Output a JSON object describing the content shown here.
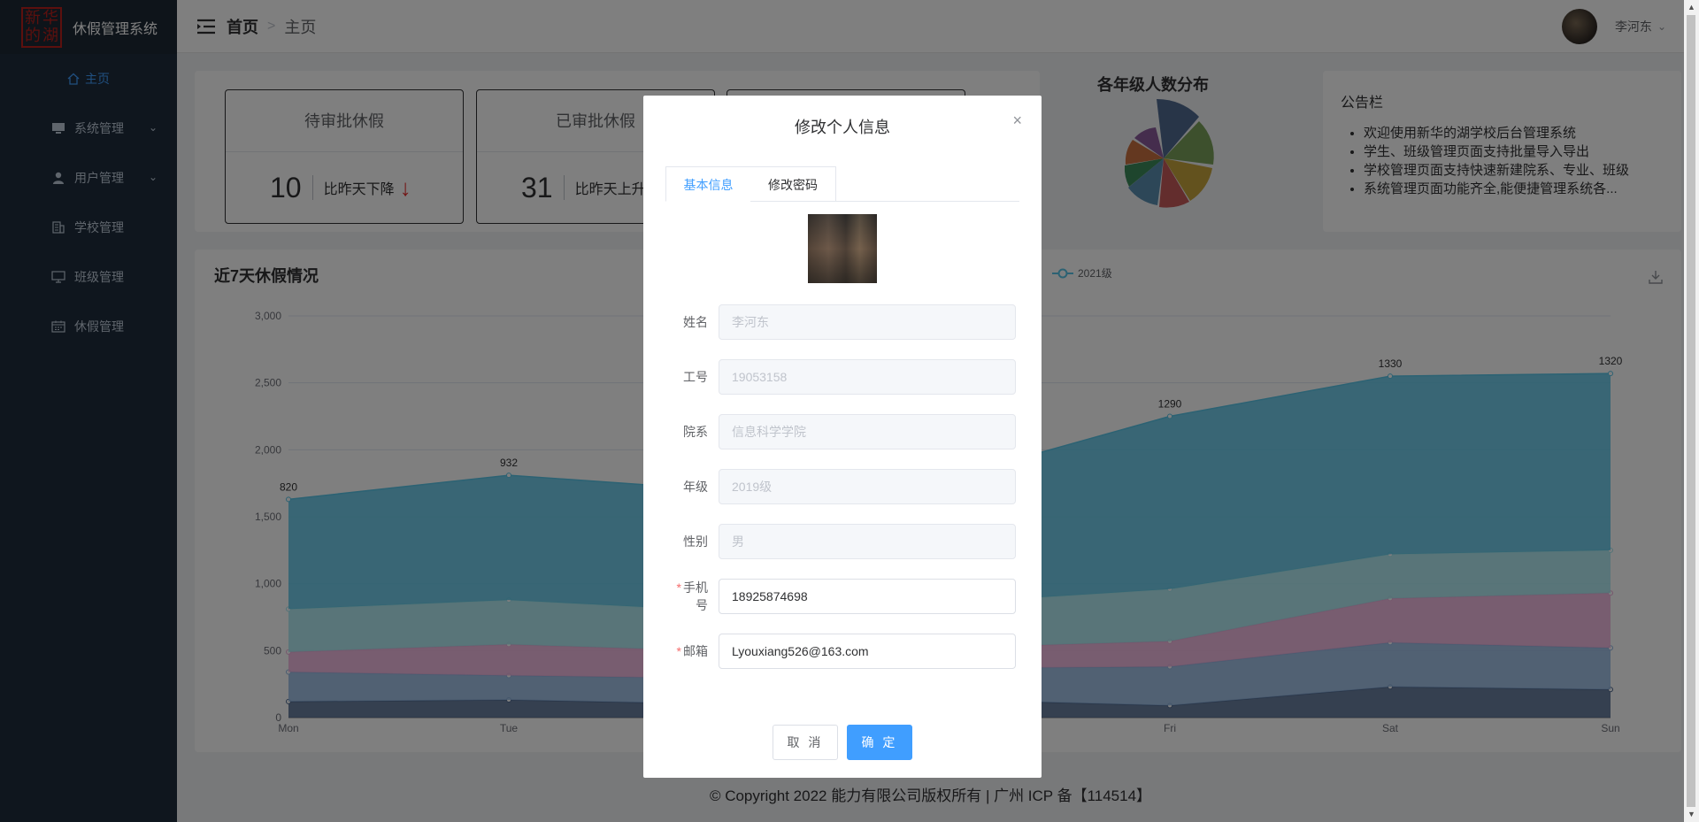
{
  "brand": {
    "logo_chars": [
      "新",
      "华",
      "的",
      "湖"
    ],
    "title": "休假管理系统"
  },
  "sidebar": {
    "items": [
      {
        "label": "主页",
        "icon": "home-icon",
        "active": true
      },
      {
        "label": "系统管理",
        "icon": "monitor-icon",
        "has_arrow": true
      },
      {
        "label": "用户管理",
        "icon": "user-icon",
        "has_arrow": true
      },
      {
        "label": "学校管理",
        "icon": "building-icon"
      },
      {
        "label": "班级管理",
        "icon": "screen-icon"
      },
      {
        "label": "休假管理",
        "icon": "calendar-icon"
      }
    ]
  },
  "header": {
    "crumb_home": "首页",
    "crumb_sep": ">",
    "crumb_current": "主页",
    "user_name": "李河东"
  },
  "stats": [
    {
      "title": "待审批休假",
      "value": "10",
      "text": "比昨天下降",
      "trend": "down"
    },
    {
      "title": "已审批休假",
      "value": "31",
      "text": "比昨天上升",
      "trend": "up"
    }
  ],
  "pie": {
    "title": "各年级人数分布"
  },
  "notice": {
    "title": "公告栏",
    "items": [
      "欢迎使用新华的湖学校后台管理系统",
      "学生、班级管理页面支持批量导入导出",
      "学校管理页面支持快速新建院系、专业、班级",
      "系统管理页面功能齐全,能便捷管理系统各..."
    ]
  },
  "chart_data": {
    "type": "area",
    "title": "近7天休假情况",
    "categories": [
      "Mon",
      "Tue",
      "Wed",
      "Thu",
      "Fri",
      "Sat",
      "Sun"
    ],
    "ylim": [
      0,
      3000
    ],
    "yticks": [
      "0",
      "500",
      "1,000",
      "1,500",
      "2,000",
      "2,500",
      "3,000"
    ],
    "stacked": true,
    "series": [
      {
        "color": "#516b91",
        "values": [
          120,
          132,
          101,
          134,
          90,
          230,
          210
        ]
      },
      {
        "color": "#93b7e3",
        "values": [
          220,
          182,
          191,
          234,
          290,
          330,
          310
        ]
      },
      {
        "color": "#edafda",
        "values": [
          150,
          232,
          201,
          154,
          190,
          330,
          410
        ]
      },
      {
        "color": "#a5e7f0",
        "values": [
          320,
          332,
          301,
          334,
          390,
          330,
          320
        ]
      },
      {
        "name": "2021级",
        "color": "#59c4e6",
        "values": [
          820,
          932,
          901,
          934,
          1290,
          1330,
          1320
        ]
      }
    ],
    "data_labels": {
      "Mon": "820",
      "Tue": "932",
      "Fri": "1290",
      "Sat": "1330",
      "Sun": "1320"
    },
    "legend_visible": [
      "2021级"
    ]
  },
  "dialog": {
    "title": "修改个人信息",
    "close": "×",
    "tabs": [
      "基本信息",
      "修改密码"
    ],
    "fields": [
      {
        "label": "姓名",
        "value": "李河东",
        "disabled": true,
        "required": false
      },
      {
        "label": "工号",
        "value": "19053158",
        "disabled": true,
        "required": false
      },
      {
        "label": "院系",
        "value": "信息科学学院",
        "disabled": true,
        "required": false
      },
      {
        "label": "年级",
        "value": "2019级",
        "disabled": true,
        "required": false
      },
      {
        "label": "性别",
        "value": "男",
        "disabled": true,
        "required": false
      },
      {
        "label": "手机号",
        "value": "18925874698",
        "disabled": false,
        "required": true
      },
      {
        "label": "邮箱",
        "value": "Lyouxiang526@163.com",
        "disabled": false,
        "required": true
      }
    ],
    "cancel_label": "取 消",
    "ok_label": "确 定"
  },
  "footer": {
    "text": "© Copyright 2022 能力有限公司版权所有 | 广州 ICP 备【114514】"
  }
}
